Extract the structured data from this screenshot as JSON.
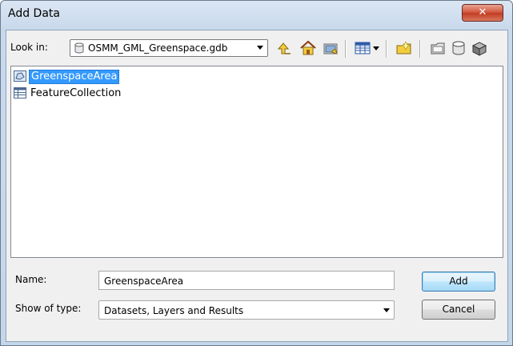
{
  "window": {
    "title": "Add Data",
    "close_glyph": "✕"
  },
  "look_in": {
    "label": "Look in:",
    "value": "OSMM_GML_Greenspace.gdb",
    "icon": "database-cylinder-icon"
  },
  "toolbar": {
    "icons": [
      "up-one-level-icon",
      "home-icon",
      "connect-to-folder-icon",
      "toggle-contents-view-icon",
      "view-dropdown-icon",
      "new-folder-icon",
      "new-file-geodatabase-icon",
      "new-personal-geodatabase-icon",
      "new-toolbox-icon"
    ]
  },
  "files": [
    {
      "name": "GreenspaceArea",
      "icon": "polygon-feature-class-icon",
      "selected": true
    },
    {
      "name": "FeatureCollection",
      "icon": "table-icon",
      "selected": false
    }
  ],
  "name_field": {
    "label": "Name:",
    "value": "GreenspaceArea"
  },
  "type_field": {
    "label": "Show of type:",
    "value": "Datasets, Layers and Results"
  },
  "buttons": {
    "add": "Add",
    "cancel": "Cancel"
  },
  "colors": {
    "selection": "#3399ff",
    "folder_yellow": "#e8c444"
  }
}
